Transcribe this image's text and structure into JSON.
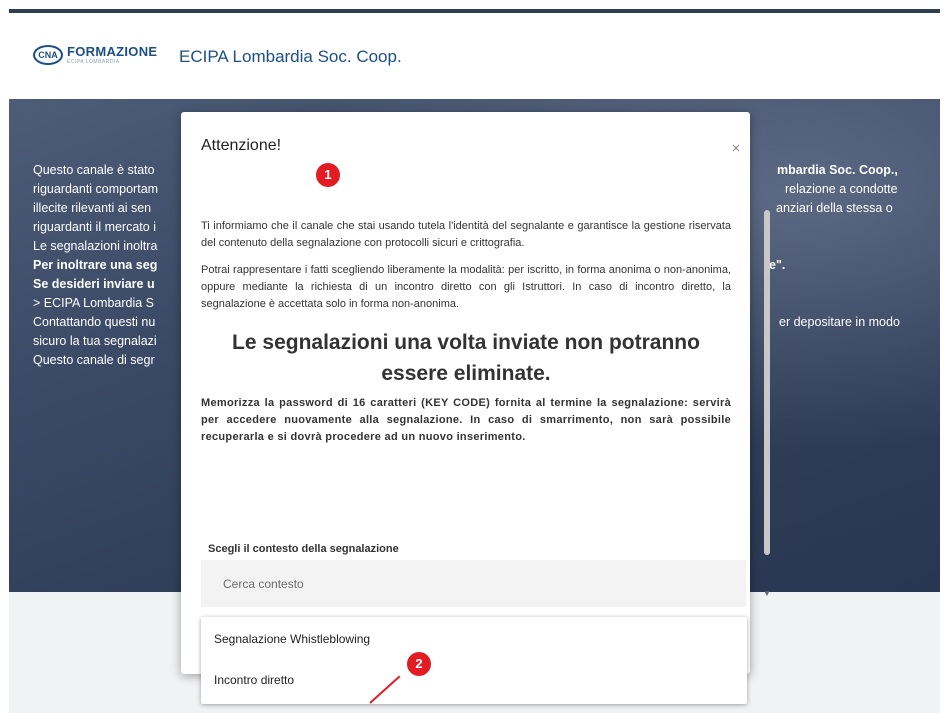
{
  "header": {
    "logo_mark": "CNA",
    "logo_title": "FORMAZIONE",
    "logo_sub": "ECIPA LOMBARDIA",
    "org_name": "ECIPA Lombardia Soc. Coop."
  },
  "background": {
    "left_lines": [
      "Questo canale è stato",
      "riguardanti comportam",
      "illecite rilevanti ai sen",
      "riguardanti il mercato i",
      "Le segnalazioni inoltra",
      "Per inoltrare una seg",
      "Se desideri inviare u",
      "> ECIPA Lombardia S",
      "Contattando questi nu",
      "sicuro la tua segnalazi",
      "Questo canale di segr"
    ],
    "right_lines": [
      "mbardia Soc. Coop.,",
      "relazione a condotte",
      "anziari della stessa o",
      "e\".",
      "er depositare in modo"
    ]
  },
  "modal": {
    "title": "Attenzione!",
    "close_label": "×",
    "para1": "Ti informiamo che il canale che stai usando tutela l'identità del segnalante e garantisce la gestione riservata del contenuto della segnalazione con protocolli sicuri e crittografia.",
    "para2": "Potrai rappresentare i fatti scegliendo liberamente la modalità: per iscritto, in forma anonima o non-anonima, oppure mediante la richiesta di un incontro diretto con gli Istruttori. In caso di incontro diretto, la segnalazione è accettata solo in forma non-anonima.",
    "headline": "Le segnalazioni una volta inviate non potranno essere eliminate.",
    "warning": "Memorizza la password di 16 caratteri (KEY CODE) fornita al termine la segnalazione: servirà per accedere nuovamente alla segnalazione. In caso di smarrimento, non sarà possibile recuperarla e si dovrà procedere ad un nuovo inserimento.",
    "context_label": "Scegli il contesto della segnalazione",
    "search_placeholder": "Cerca contesto"
  },
  "dropdown": {
    "options": [
      "Segnalazione Whistleblowing",
      "Incontro diretto"
    ]
  },
  "annotations": {
    "badge1": "1",
    "badge2": "2",
    "color": "#e31b23"
  }
}
